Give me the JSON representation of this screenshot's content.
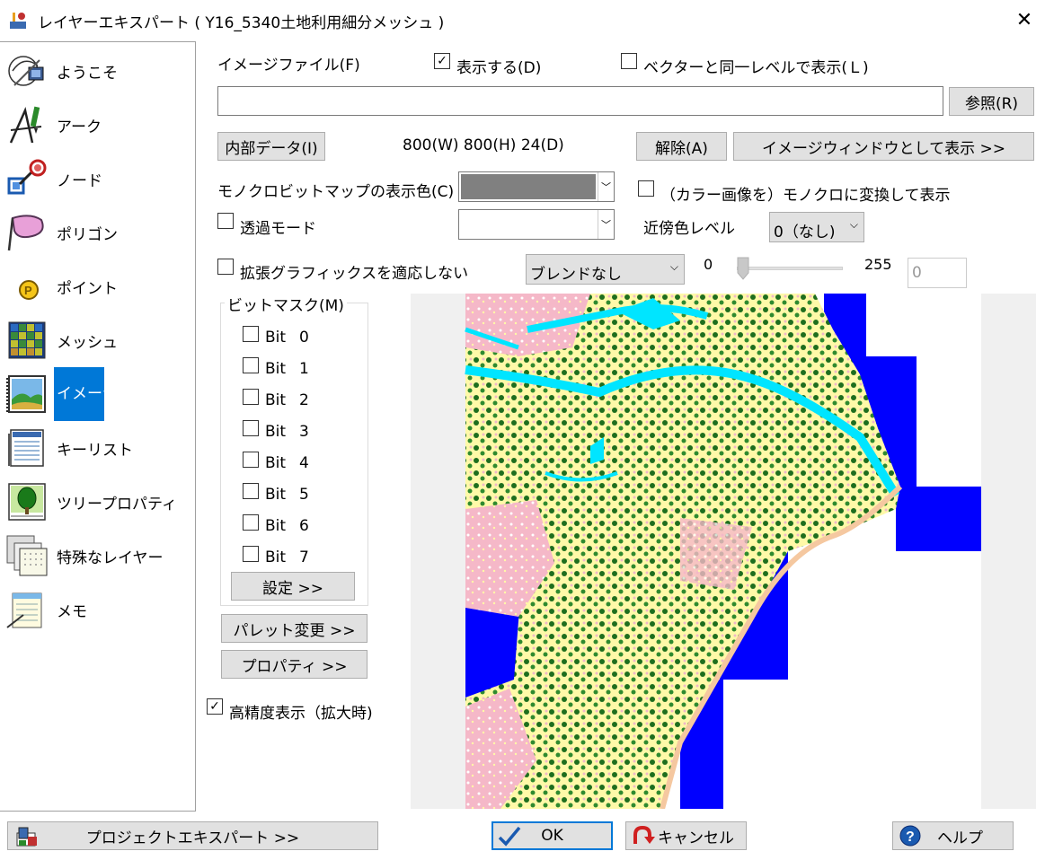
{
  "window": {
    "title": "レイヤーエキスパート ( Y16_5340土地利用細分メッシュ )",
    "close_glyph": "✕"
  },
  "sidebar": {
    "items": [
      {
        "label": "ようこそ",
        "icon": "welcome-icon"
      },
      {
        "label": "アーク",
        "icon": "arc-icon"
      },
      {
        "label": "ノード",
        "icon": "node-icon"
      },
      {
        "label": "ポリゴン",
        "icon": "polygon-icon"
      },
      {
        "label": "ポイント",
        "icon": "point-icon"
      },
      {
        "label": "メッシュ",
        "icon": "mesh-icon"
      },
      {
        "label": "イメージ",
        "icon": "image-icon",
        "selected": true
      },
      {
        "label": "キーリスト",
        "icon": "keylist-icon"
      },
      {
        "label": "ツリープロパティ",
        "icon": "tree-icon"
      },
      {
        "label": "特殊なレイヤー",
        "icon": "special-layer-icon"
      },
      {
        "label": "メモ",
        "icon": "memo-icon"
      }
    ]
  },
  "image_panel": {
    "image_file_label": "イメージファイル(F)",
    "show_checkbox": {
      "label": "表示する(D)",
      "checked": true
    },
    "same_level_checkbox": {
      "label": "ベクターと同一レベルで表示(Ｌ)",
      "checked": false
    },
    "file_path": "",
    "browse_button": "参照(R)",
    "internal_data_button": "内部データ(I)",
    "image_info": "800(W) 800(H) 24(D)",
    "release_button": "解除(A)",
    "show_as_window_button": "イメージウィンドウとして表示 >>",
    "mono_color_label": "モノクロビットマップの表示色(C)",
    "mono_color_value": "#808080",
    "convert_mono_checkbox": {
      "label": "（カラー画像を）モノクロに変換して表示",
      "checked": false
    },
    "transparent_checkbox": {
      "label": "透過モード",
      "checked": false
    },
    "transparent_color_value": "#ffffff",
    "neighbor_level_label": "近傍色レベル",
    "neighbor_level_value": "0（なし)",
    "ext_graphics_checkbox": {
      "label": "拡張グラフィックスを適応しない",
      "checked": false
    },
    "blend_value": "ブレンドなし",
    "slider_min": "0",
    "slider_max": "255",
    "slider_value": "0",
    "slider_level": 0,
    "bitmask": {
      "legend": "ビットマスク(M)",
      "bits": [
        {
          "label": "Bit",
          "num": "0"
        },
        {
          "label": "Bit",
          "num": "1"
        },
        {
          "label": "Bit",
          "num": "2"
        },
        {
          "label": "Bit",
          "num": "3"
        },
        {
          "label": "Bit",
          "num": "4"
        },
        {
          "label": "Bit",
          "num": "5"
        },
        {
          "label": "Bit",
          "num": "6"
        },
        {
          "label": "Bit",
          "num": "7"
        }
      ],
      "set_button": "設定 >>"
    },
    "palette_button": "パレット変更 >>",
    "property_button": "プロパティ >>",
    "high_precision_checkbox": {
      "label": "高精度表示（拡大時)",
      "checked": true
    }
  },
  "bottom": {
    "project_expert_button": "プロジェクトエキスパート >>",
    "ok_button": "OK",
    "cancel_button": "キャンセル",
    "help_button": "ヘルプ"
  },
  "colors": {
    "accent": "#0078d7",
    "sea": "#0000ff",
    "river": "#00e5ff",
    "farmland": "#ffff99",
    "forest": "#1e6e1e",
    "urban": "#f5b8c8"
  }
}
